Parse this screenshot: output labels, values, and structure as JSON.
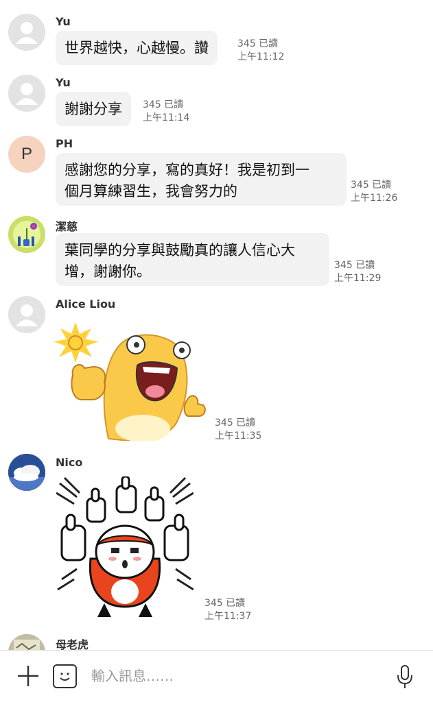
{
  "messages": [
    {
      "sender": "Yu",
      "text": "世界越快，心越慢。讚",
      "read": "345 已讀",
      "time": "上午11:12",
      "avatar": "default-avatar-icon"
    },
    {
      "sender": "Yu",
      "text": "謝謝分享",
      "read": "345 已讀",
      "time": "上午11:14",
      "avatar": "default-avatar-icon"
    },
    {
      "sender": "PH",
      "avatar_letter": "P",
      "lines": [
        "感謝您的分享，寫的真好！我是初到一",
        "個月算練習生，我會努力的"
      ],
      "read": "345 已讀",
      "time": "上午11:26"
    },
    {
      "sender": "潔慈",
      "lines": [
        "葉同學的分享與鼓勵真的讓人信心大",
        "增，謝謝你。"
      ],
      "read": "345 已讀",
      "time": "上午11:29",
      "avatar": "flower-avatar-icon"
    },
    {
      "sender": "Alice Liou",
      "sticker": "thumbs-up-character-sticker",
      "read": "345 已讀",
      "time": "上午11:35",
      "avatar": "default-avatar-icon"
    },
    {
      "sender": "Nico",
      "sticker": "many-thumbs-up-sticker",
      "read": "345 已讀",
      "time": "上午11:37",
      "avatar": "cloud-sky-avatar-icon"
    },
    {
      "sender": "母老虎",
      "avatar": "photo-avatar-icon"
    }
  ],
  "input": {
    "placeholder": "輸入訊息……"
  },
  "icons": {
    "plus": "plus-icon",
    "emoji": "emoji-icon",
    "mic": "microphone-icon"
  },
  "colors": {
    "bubble": "#f2f2f2",
    "meta_text": "#666666",
    "avatar_p_bg": "#f6d3bf"
  }
}
